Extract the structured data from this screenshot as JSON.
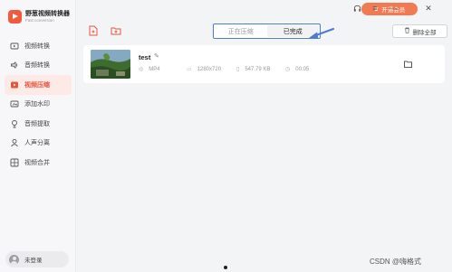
{
  "app": {
    "name": "野葱视频转换器",
    "subtitle": "Fast conversion"
  },
  "sidebar": {
    "items": [
      {
        "label": "视频转换",
        "icon": "video-convert-icon"
      },
      {
        "label": "音频转换",
        "icon": "audio-convert-icon"
      },
      {
        "label": "视频压缩",
        "icon": "video-compress-icon",
        "active": true
      },
      {
        "label": "添加水印",
        "icon": "watermark-icon"
      },
      {
        "label": "音频提取",
        "icon": "audio-extract-icon"
      },
      {
        "label": "人声分离",
        "icon": "voice-separate-icon"
      },
      {
        "label": "视频合并",
        "icon": "video-merge-icon"
      }
    ],
    "login_label": "未登录"
  },
  "header": {
    "vip_label": "开通会员"
  },
  "tabs": [
    {
      "label": "正在压缩",
      "active": false
    },
    {
      "label": "已完成",
      "active": true
    }
  ],
  "toolbar": {
    "clear_label": "删除全部"
  },
  "file": {
    "name": "test",
    "format": "MP4",
    "resolution": "1280x720",
    "size": "547.79 KB",
    "duration": "00:05"
  },
  "watermark": "CSDN @嗨格式",
  "colors": {
    "accent": "#e8543b",
    "vip": "#f27a52",
    "highlight": "#4a7cd8"
  }
}
